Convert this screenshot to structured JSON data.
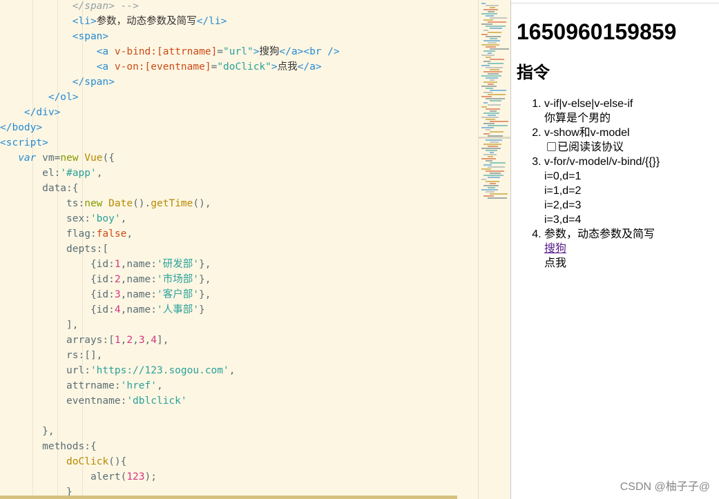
{
  "editor": {
    "lines": [
      [
        [
          "            ",
          "tok-plain"
        ],
        [
          "</span> -->",
          "tok-cmt"
        ]
      ],
      [
        [
          "            ",
          "tok-plain"
        ],
        [
          "<li>",
          "tok-tag"
        ],
        [
          "参数，动态参数及简写",
          "tok-txt"
        ],
        [
          "</li>",
          "tok-tag"
        ]
      ],
      [
        [
          "            ",
          "tok-plain"
        ],
        [
          "<span>",
          "tok-tag"
        ]
      ],
      [
        [
          "                ",
          "tok-plain"
        ],
        [
          "<a ",
          "tok-tag"
        ],
        [
          "v-bind:[attrname]",
          "tok-attr"
        ],
        [
          "=",
          "tok-plain"
        ],
        [
          "\"url\"",
          "tok-str"
        ],
        [
          ">",
          "tok-tag"
        ],
        [
          "搜狗",
          "tok-txt"
        ],
        [
          "</a><br />",
          "tok-tag"
        ]
      ],
      [
        [
          "                ",
          "tok-plain"
        ],
        [
          "<a ",
          "tok-tag"
        ],
        [
          "v-on:[eventname]",
          "tok-attr"
        ],
        [
          "=",
          "tok-plain"
        ],
        [
          "\"doClick\"",
          "tok-str"
        ],
        [
          ">",
          "tok-tag"
        ],
        [
          "点我",
          "tok-txt"
        ],
        [
          "</a>",
          "tok-tag"
        ]
      ],
      [
        [
          "            ",
          "tok-plain"
        ],
        [
          "</span>",
          "tok-tag"
        ]
      ],
      [
        [
          "        ",
          "tok-plain"
        ],
        [
          "</ol>",
          "tok-tag"
        ]
      ],
      [
        [
          "    ",
          "tok-plain"
        ],
        [
          "</div>",
          "tok-tag"
        ]
      ],
      [
        [
          "</body>",
          "tok-tag"
        ]
      ],
      [
        [
          "<script>",
          "tok-tag"
        ]
      ],
      [
        [
          "   ",
          "tok-plain"
        ],
        [
          "var",
          "tok-kw"
        ],
        [
          " vm=",
          "tok-plain"
        ],
        [
          "new",
          "tok-new"
        ],
        [
          " ",
          "tok-plain"
        ],
        [
          "Vue",
          "tok-cls"
        ],
        [
          "({",
          "tok-plain"
        ]
      ],
      [
        [
          "       el:",
          "tok-plain"
        ],
        [
          "'#app'",
          "tok-str"
        ],
        [
          ",",
          "tok-plain"
        ]
      ],
      [
        [
          "       data:{",
          "tok-plain"
        ]
      ],
      [
        [
          "           ts:",
          "tok-plain"
        ],
        [
          "new",
          "tok-new"
        ],
        [
          " ",
          "tok-plain"
        ],
        [
          "Date",
          "tok-cls"
        ],
        [
          "().",
          "tok-plain"
        ],
        [
          "getTime",
          "tok-fn"
        ],
        [
          "(),",
          "tok-plain"
        ]
      ],
      [
        [
          "           sex:",
          "tok-plain"
        ],
        [
          "'boy'",
          "tok-str"
        ],
        [
          ",",
          "tok-plain"
        ]
      ],
      [
        [
          "           flag:",
          "tok-plain"
        ],
        [
          "false",
          "tok-bool"
        ],
        [
          ",",
          "tok-plain"
        ]
      ],
      [
        [
          "           depts:[",
          "tok-plain"
        ]
      ],
      [
        [
          "               {id:",
          "tok-plain"
        ],
        [
          "1",
          "tok-num"
        ],
        [
          ",name:",
          "tok-plain"
        ],
        [
          "'研发部'",
          "tok-str"
        ],
        [
          "},",
          "tok-plain"
        ]
      ],
      [
        [
          "               {id:",
          "tok-plain"
        ],
        [
          "2",
          "tok-num"
        ],
        [
          ",name:",
          "tok-plain"
        ],
        [
          "'市场部'",
          "tok-str"
        ],
        [
          "},",
          "tok-plain"
        ]
      ],
      [
        [
          "               {id:",
          "tok-plain"
        ],
        [
          "3",
          "tok-num"
        ],
        [
          ",name:",
          "tok-plain"
        ],
        [
          "'客户部'",
          "tok-str"
        ],
        [
          "},",
          "tok-plain"
        ]
      ],
      [
        [
          "               {id:",
          "tok-plain"
        ],
        [
          "4",
          "tok-num"
        ],
        [
          ",name:",
          "tok-plain"
        ],
        [
          "'人事部'",
          "tok-str"
        ],
        [
          "}",
          "tok-plain"
        ]
      ],
      [
        [
          "           ],",
          "tok-plain"
        ]
      ],
      [
        [
          "           arrays:[",
          "tok-plain"
        ],
        [
          "1",
          "tok-num"
        ],
        [
          ",",
          "tok-plain"
        ],
        [
          "2",
          "tok-num"
        ],
        [
          ",",
          "tok-plain"
        ],
        [
          "3",
          "tok-num"
        ],
        [
          ",",
          "tok-plain"
        ],
        [
          "4",
          "tok-num"
        ],
        [
          "],",
          "tok-plain"
        ]
      ],
      [
        [
          "           rs:[],",
          "tok-plain"
        ]
      ],
      [
        [
          "           url:",
          "tok-plain"
        ],
        [
          "'https://123.sogou.com'",
          "tok-str"
        ],
        [
          ",",
          "tok-plain"
        ]
      ],
      [
        [
          "           attrname:",
          "tok-plain"
        ],
        [
          "'href'",
          "tok-str"
        ],
        [
          ",",
          "tok-plain"
        ]
      ],
      [
        [
          "           eventname:",
          "tok-plain"
        ],
        [
          "'dblclick'",
          "tok-str"
        ]
      ],
      [
        [
          "",
          "tok-plain"
        ]
      ],
      [
        [
          "       },",
          "tok-plain"
        ]
      ],
      [
        [
          "       methods:{",
          "tok-plain"
        ]
      ],
      [
        [
          "           ",
          "tok-plain"
        ],
        [
          "doClick",
          "tok-fn"
        ],
        [
          "(){",
          "tok-plain"
        ]
      ],
      [
        [
          "               alert(",
          "tok-plain"
        ],
        [
          "123",
          "tok-num"
        ],
        [
          ");",
          "tok-plain"
        ]
      ],
      [
        [
          "           }",
          "tok-plain"
        ]
      ]
    ]
  },
  "preview": {
    "timestamp": "1650960159859",
    "section_title": "指令",
    "items": [
      {
        "title": "v-if|v-else|v-else-if",
        "content": "你算是个男的"
      },
      {
        "title": "v-show和v-model",
        "checkbox_label": "已阅读该协议"
      },
      {
        "title": "v-for/v-model/v-bind/{{}}",
        "rows": [
          "i=0,d=1",
          "i=1,d=2",
          "i=2,d=3",
          "i=3,d=4"
        ]
      },
      {
        "title": "参数，动态参数及简写",
        "link_sogou": "搜狗",
        "link_click": "点我"
      }
    ]
  },
  "watermark": "CSDN @柚子子@",
  "colors": {
    "editor_bg": "#fdf6e3",
    "tag": "#268bd2",
    "attr": "#cb4b16",
    "string": "#2aa198",
    "number": "#d33682",
    "keyword_new": "#859900",
    "class_fn": "#b58900"
  }
}
